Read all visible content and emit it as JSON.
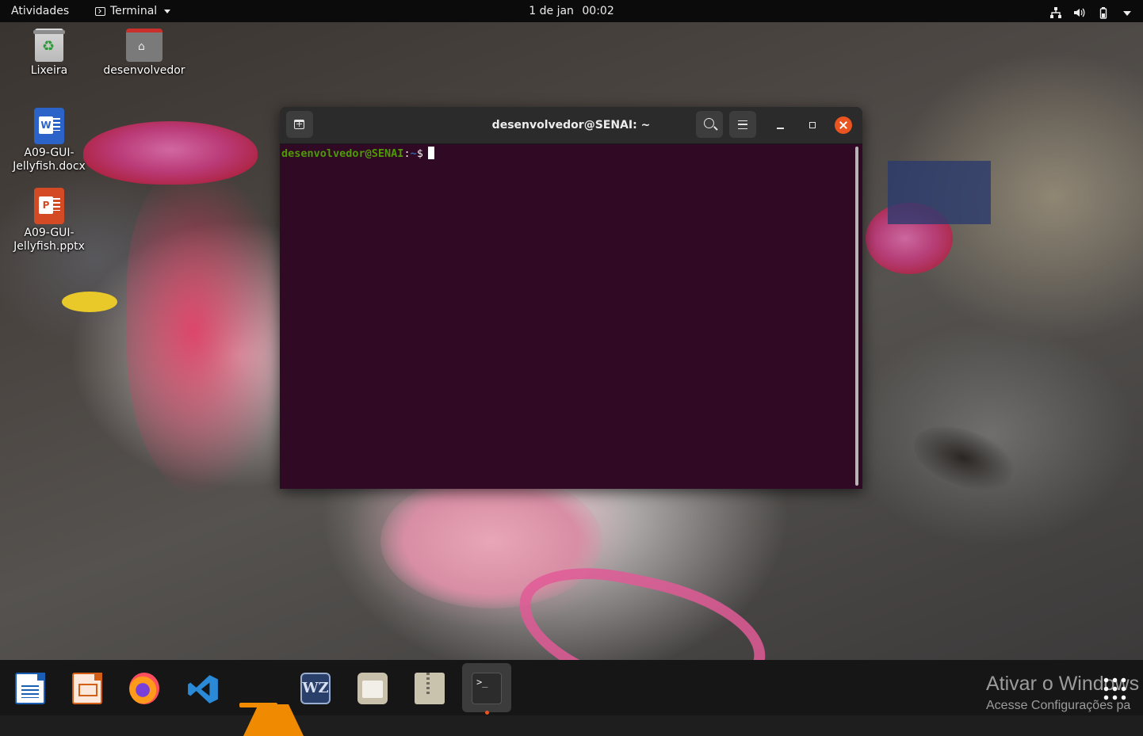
{
  "topbar": {
    "activities": "Atividades",
    "app_name": "Terminal",
    "date": "1 de jan",
    "time": "00:02",
    "tray_icons": [
      "network-icon",
      "volume-icon",
      "battery-icon",
      "system-menu-icon"
    ]
  },
  "desktop": {
    "icons": [
      {
        "label": "Lixeira",
        "icon": "trash-icon"
      },
      {
        "label": "desenvolvedor",
        "icon": "home-folder-icon"
      },
      {
        "label": "A09-GUI-Jellyfish.docx",
        "line1": "A09-GUI-",
        "line2": "Jellyfish.docx",
        "icon": "word-document-icon"
      },
      {
        "label": "A09-GUI-Jellyfish.pptx",
        "line1": "A09-GUI-",
        "line2": "Jellyfish.pptx",
        "icon": "powerpoint-document-icon"
      }
    ]
  },
  "terminal": {
    "title": "desenvolvedor@SENAI: ~",
    "prompt_user_host": "desenvolvedor@SENAI",
    "prompt_sep": ":",
    "prompt_path": "~",
    "prompt_symbol": "$",
    "colors": {
      "background": "#300a24",
      "user": "#4e9a06",
      "path": "#3465a4",
      "close": "#e95420"
    }
  },
  "dock": {
    "items": [
      {
        "name": "libreoffice-writer",
        "icon": "writer-icon"
      },
      {
        "name": "libreoffice-impress",
        "icon": "impress-icon"
      },
      {
        "name": "firefox",
        "icon": "firefox-icon"
      },
      {
        "name": "visual-studio-code",
        "icon": "vscode-icon"
      },
      {
        "name": "vlc",
        "icon": "vlc-icon"
      },
      {
        "name": "warzone-2100",
        "icon": "wz-icon",
        "text": "WZ"
      },
      {
        "name": "files",
        "icon": "files-icon"
      },
      {
        "name": "archive-manager",
        "icon": "archive-icon"
      },
      {
        "name": "terminal",
        "icon": "terminal-icon",
        "text": ">_",
        "active": true
      }
    ]
  },
  "watermark": {
    "title": "Ativar o Windows",
    "subtitle": "Acesse Configurações pa"
  }
}
